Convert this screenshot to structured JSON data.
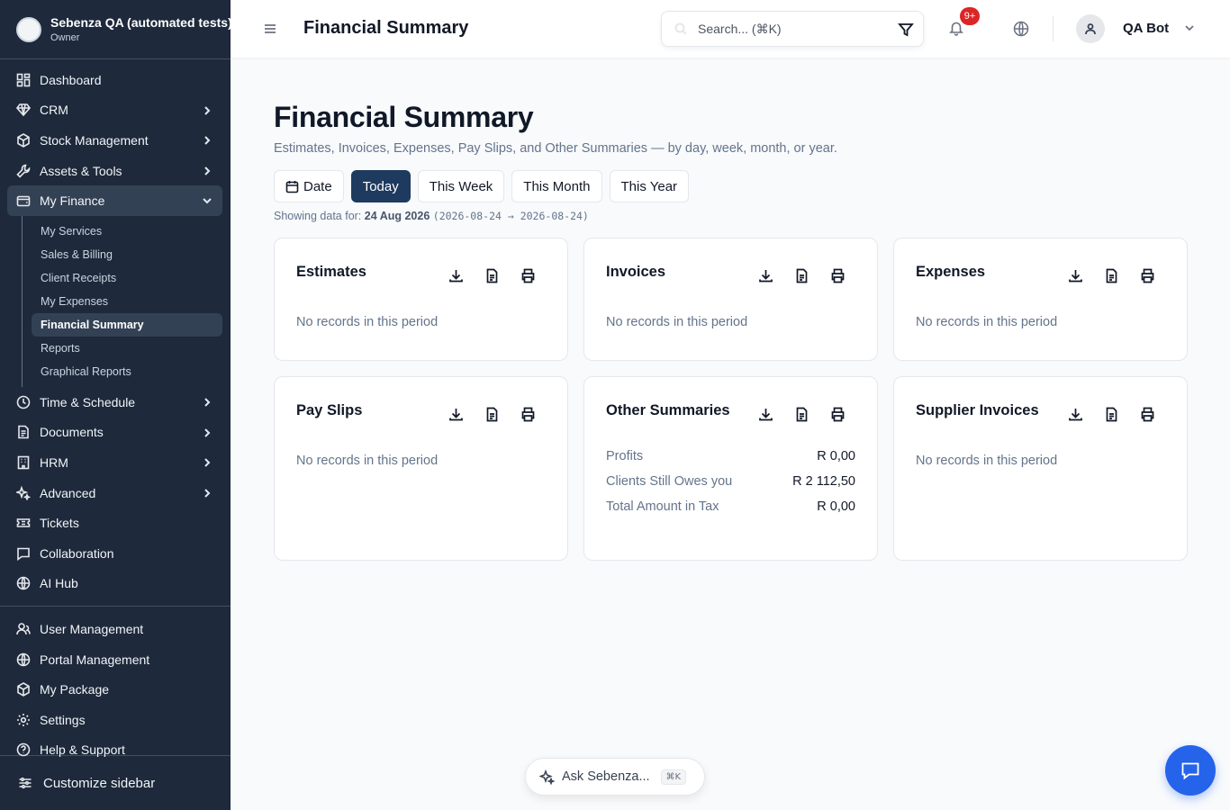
{
  "org": {
    "name": "Sebenza QA (automated tests)",
    "role": "Owner"
  },
  "sidebar": {
    "items": [
      {
        "label": "Dashboard",
        "icon": "dashboard-icon",
        "has_chevron": false
      },
      {
        "label": "CRM",
        "icon": "diamond-icon",
        "has_chevron": true
      },
      {
        "label": "Stock Management",
        "icon": "box-icon",
        "has_chevron": true
      },
      {
        "label": "Assets & Tools",
        "icon": "wrench-icon",
        "has_chevron": true
      },
      {
        "label": "My Finance",
        "icon": "wallet-icon",
        "has_chevron": true,
        "expanded": true
      }
    ],
    "finance_sub": [
      {
        "label": "My Services"
      },
      {
        "label": "Sales & Billing"
      },
      {
        "label": "Client Receipts"
      },
      {
        "label": "My Expenses"
      },
      {
        "label": "Financial Summary",
        "active": true
      },
      {
        "label": "Reports"
      },
      {
        "label": "Graphical Reports"
      }
    ],
    "items_after": [
      {
        "label": "Time & Schedule",
        "icon": "clock-icon",
        "has_chevron": true
      },
      {
        "label": "Documents",
        "icon": "document-icon",
        "has_chevron": true
      },
      {
        "label": "HRM",
        "icon": "building-icon",
        "has_chevron": true
      },
      {
        "label": "Advanced",
        "icon": "sparkle-icon",
        "has_chevron": true
      },
      {
        "label": "Tickets",
        "icon": "ticket-icon",
        "has_chevron": false
      },
      {
        "label": "Collaboration",
        "icon": "chat-icon",
        "has_chevron": false
      },
      {
        "label": "AI Hub",
        "icon": "globe-icon",
        "has_chevron": false
      }
    ],
    "items_bottom": [
      {
        "label": "User Management",
        "icon": "users-icon"
      },
      {
        "label": "Portal Management",
        "icon": "globe-icon"
      },
      {
        "label": "My Package",
        "icon": "box-icon"
      },
      {
        "label": "Settings",
        "icon": "gear-icon"
      },
      {
        "label": "Help & Support",
        "icon": "help-icon"
      }
    ],
    "customize_label": "Customize sidebar"
  },
  "header": {
    "title": "Financial Summary",
    "search_placeholder": "Search... (⌘K)",
    "notification_badge": "9+",
    "user_name": "QA Bot"
  },
  "main": {
    "title": "Financial Summary",
    "subtitle": "Estimates, Invoices, Expenses, Pay Slips, and Other Summaries — by day, week, month, or year.",
    "ranges": [
      {
        "label": "Date",
        "icon": "calendar-icon",
        "active": false
      },
      {
        "label": "Today",
        "active": true
      },
      {
        "label": "This Week",
        "active": false
      },
      {
        "label": "This Month",
        "active": false
      },
      {
        "label": "This Year",
        "active": false
      }
    ],
    "showing_prefix": "Showing data for:",
    "showing_date": "24 Aug 2026",
    "showing_range": "(2026-08-24 → 2026-08-24)",
    "cards": [
      {
        "title": "Estimates",
        "empty_text": "No records in this period"
      },
      {
        "title": "Invoices",
        "empty_text": "No records in this period"
      },
      {
        "title": "Expenses",
        "empty_text": "No records in this period"
      },
      {
        "title": "Pay Slips",
        "empty_text": "No records in this period"
      },
      {
        "title": "Other Summaries",
        "rows": [
          {
            "label": "Profits",
            "value": "R 0,00"
          },
          {
            "label": "Clients Still Owes you",
            "value": "R 2 112,50"
          },
          {
            "label": "Total Amount in Tax",
            "value": "R 0,00"
          }
        ]
      },
      {
        "title": "Supplier Invoices",
        "empty_text": "No records in this period"
      }
    ]
  },
  "ask": {
    "label": "Ask Sebenza...",
    "shortcut": "⌘K"
  },
  "colors": {
    "sidebar_bg": "#1e293b",
    "active_range": "#1e3a5f",
    "chat_button": "#2563eb",
    "badge": "#dc2626"
  }
}
